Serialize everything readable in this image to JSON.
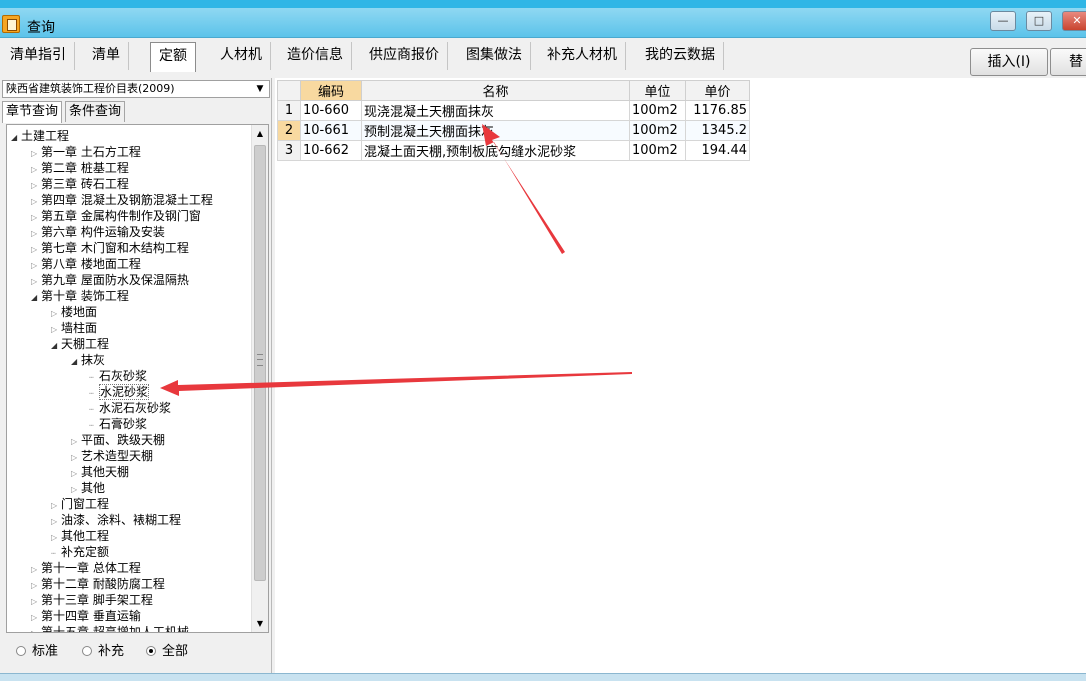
{
  "window": {
    "title": "查询",
    "min_label": "—",
    "max_label": "□",
    "close_label": "✕"
  },
  "tabs": [
    {
      "label": "清单指引",
      "active": false
    },
    {
      "label": "清单",
      "active": false
    },
    {
      "label": "定额",
      "active": true
    },
    {
      "label": "人材机",
      "active": false
    },
    {
      "label": "造价信息",
      "active": false
    },
    {
      "label": "供应商报价",
      "active": false
    },
    {
      "label": "图集做法",
      "active": false
    },
    {
      "label": "补充人材机",
      "active": false
    },
    {
      "label": "我的云数据",
      "active": false
    }
  ],
  "actions": {
    "insert_label": "插入(I)",
    "replace_label": "替"
  },
  "left_panel": {
    "library_selected": "陕西省建筑装饰工程价目表(2009)",
    "subtabs": [
      {
        "label": "章节查询",
        "active": true
      },
      {
        "label": "条件查询",
        "active": false
      }
    ],
    "tree": [
      {
        "label": "土建工程",
        "level": 0,
        "toggle": "open"
      },
      {
        "label": "第一章  土石方工程",
        "level": 1,
        "toggle": "closed"
      },
      {
        "label": "第二章  桩基工程",
        "level": 1,
        "toggle": "closed"
      },
      {
        "label": "第三章  砖石工程",
        "level": 1,
        "toggle": "closed"
      },
      {
        "label": "第四章  混凝土及钢筋混凝土工程",
        "level": 1,
        "toggle": "closed"
      },
      {
        "label": "第五章  金属构件制作及钢门窗",
        "level": 1,
        "toggle": "closed"
      },
      {
        "label": "第六章  构件运输及安装",
        "level": 1,
        "toggle": "closed"
      },
      {
        "label": "第七章  木门窗和木结构工程",
        "level": 1,
        "toggle": "closed"
      },
      {
        "label": "第八章  楼地面工程",
        "level": 1,
        "toggle": "closed"
      },
      {
        "label": "第九章  屋面防水及保温隔热",
        "level": 1,
        "toggle": "closed"
      },
      {
        "label": "第十章  装饰工程",
        "level": 1,
        "toggle": "open"
      },
      {
        "label": "楼地面",
        "level": 2,
        "toggle": "closed"
      },
      {
        "label": "墙柱面",
        "level": 2,
        "toggle": "closed"
      },
      {
        "label": "天棚工程",
        "level": 2,
        "toggle": "open"
      },
      {
        "label": "抹灰",
        "level": 3,
        "toggle": "open"
      },
      {
        "label": "石灰砂浆",
        "level": 4,
        "toggle": "leaf"
      },
      {
        "label": "水泥砂浆",
        "level": 4,
        "toggle": "leaf",
        "selected": true
      },
      {
        "label": "水泥石灰砂浆",
        "level": 4,
        "toggle": "leaf"
      },
      {
        "label": "石膏砂浆",
        "level": 4,
        "toggle": "leaf"
      },
      {
        "label": "平面、跌级天棚",
        "level": 3,
        "toggle": "closed"
      },
      {
        "label": "艺术造型天棚",
        "level": 3,
        "toggle": "closed"
      },
      {
        "label": "其他天棚",
        "level": 3,
        "toggle": "closed"
      },
      {
        "label": "其他",
        "level": 3,
        "toggle": "closed"
      },
      {
        "label": "门窗工程",
        "level": 2,
        "toggle": "closed"
      },
      {
        "label": "油漆、涂料、裱糊工程",
        "level": 2,
        "toggle": "closed"
      },
      {
        "label": "其他工程",
        "level": 2,
        "toggle": "closed"
      },
      {
        "label": "补充定额",
        "level": 2,
        "toggle": "leaf"
      },
      {
        "label": "第十一章  总体工程",
        "level": 1,
        "toggle": "closed"
      },
      {
        "label": "第十二章  耐酸防腐工程",
        "level": 1,
        "toggle": "closed"
      },
      {
        "label": "第十三章  脚手架工程",
        "level": 1,
        "toggle": "closed"
      },
      {
        "label": "第十四章  垂直运输",
        "level": 1,
        "toggle": "closed"
      },
      {
        "label": "第十五章  超高增加人工机械",
        "level": 1,
        "toggle": "closed"
      }
    ],
    "filters": [
      {
        "label": "标准",
        "checked": false
      },
      {
        "label": "补充",
        "checked": false
      },
      {
        "label": "全部",
        "checked": true
      }
    ]
  },
  "grid": {
    "columns": [
      "编码",
      "名称",
      "单位",
      "单价"
    ],
    "rows": [
      {
        "num": "1",
        "code": "10-660",
        "name": "现浇混凝土天棚面抹灰",
        "unit": "100m2",
        "price": "1176.85",
        "selected": false
      },
      {
        "num": "2",
        "code": "10-661",
        "name": "预制混凝土天棚面抹灰",
        "unit": "100m2",
        "price": "1345.2",
        "selected": true
      },
      {
        "num": "3",
        "code": "10-662",
        "name": "混凝土面天棚,预制板底勾缝水泥砂浆",
        "unit": "100m2",
        "price": "194.44",
        "selected": false
      }
    ]
  },
  "colors": {
    "annotation_arrow": "#e8383d",
    "titlebar": "#5cc3ea",
    "selected_header": "#f8d9a0"
  }
}
